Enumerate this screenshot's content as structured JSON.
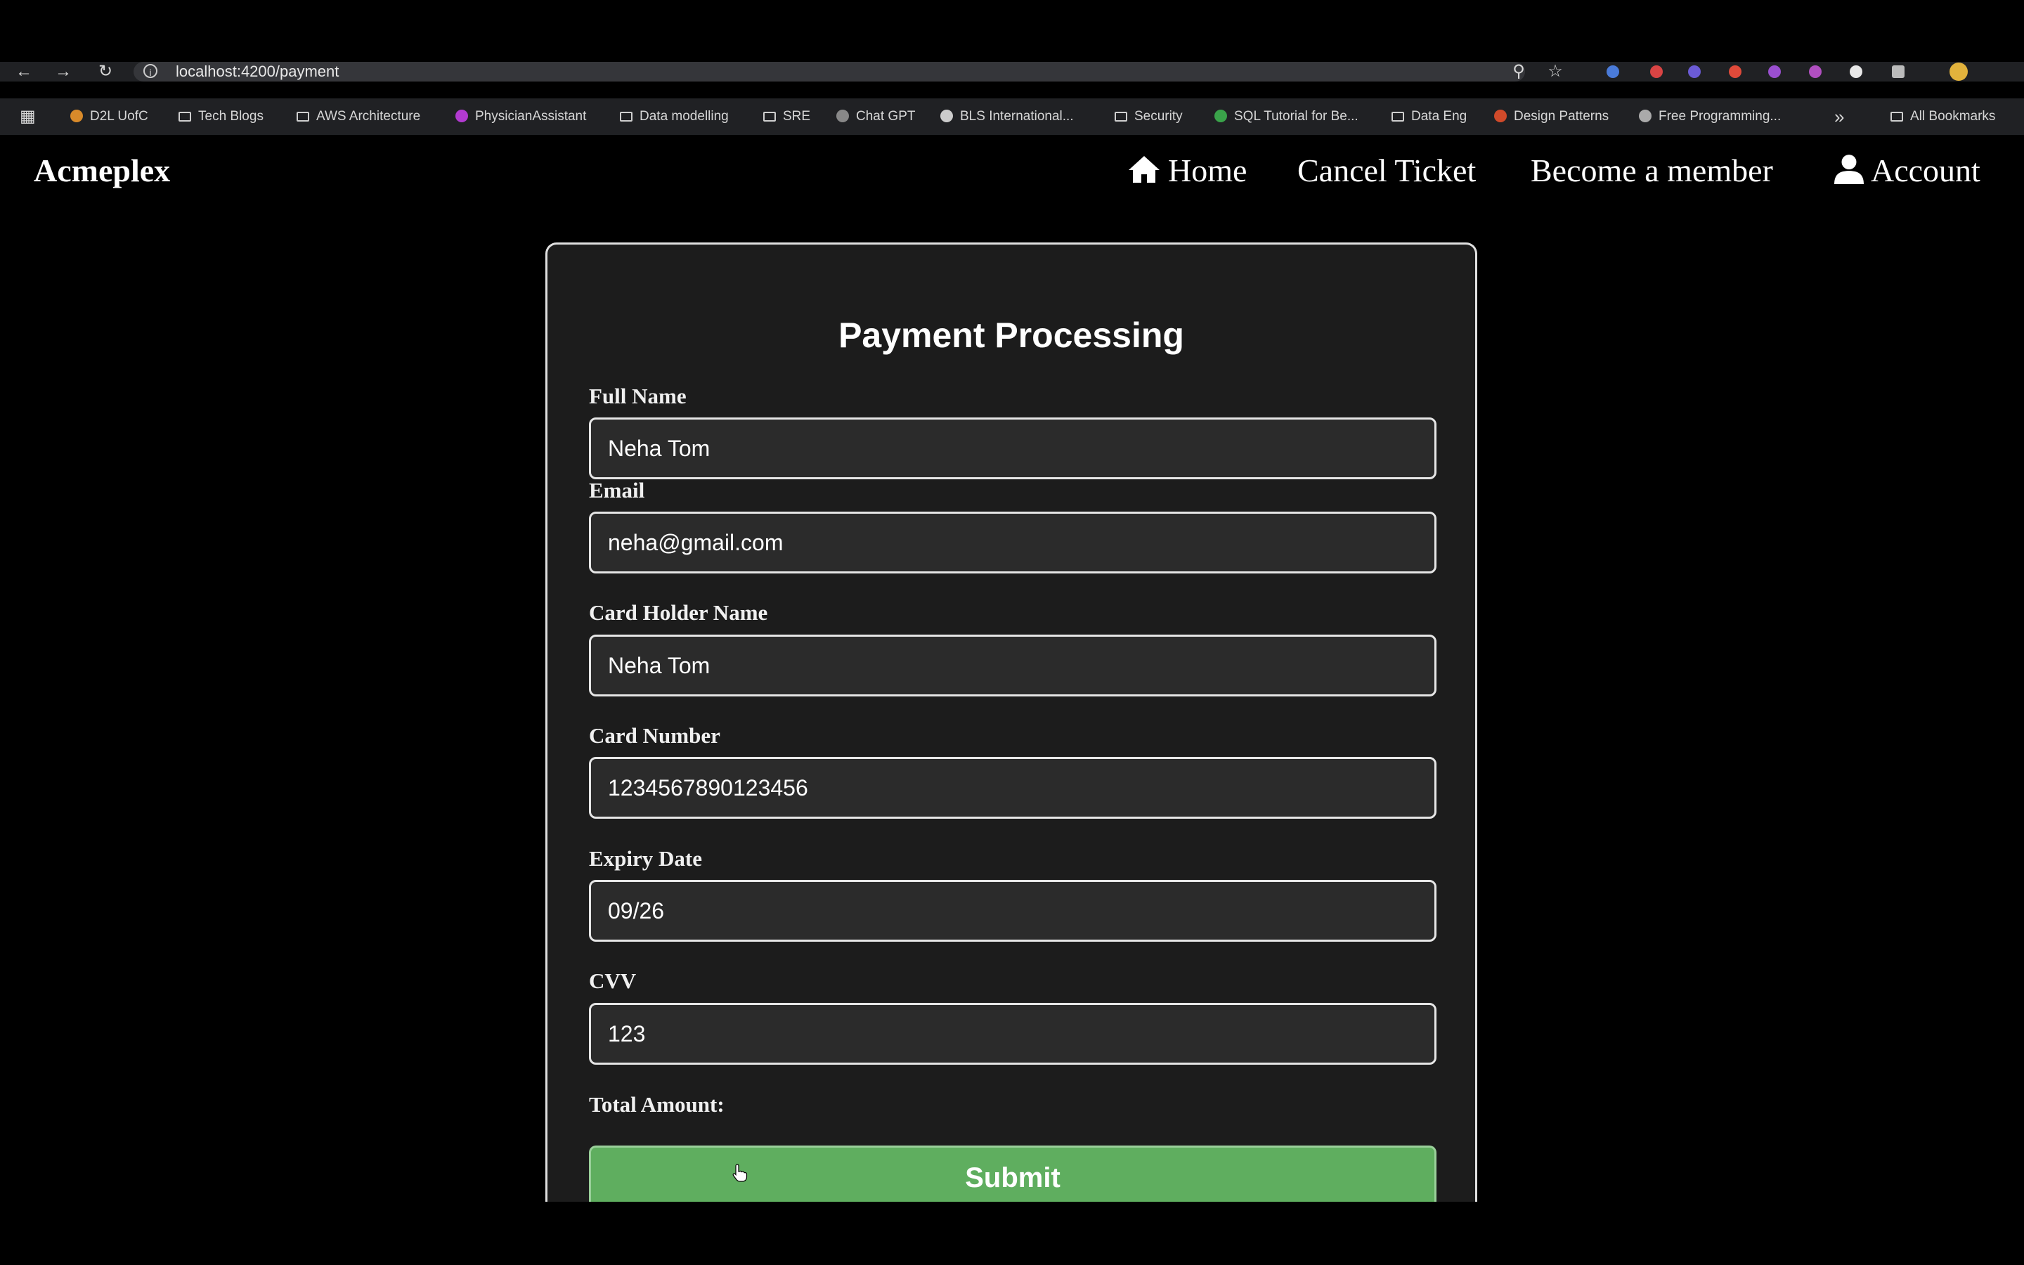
{
  "browser": {
    "url": "localhost:4200/payment",
    "bookmarks": [
      "D2L UofC",
      "Tech Blogs",
      "AWS Architecture",
      "PhysicianAssistant",
      "Data modelling",
      "SRE",
      "Chat GPT",
      "BLS International...",
      "Security",
      "SQL Tutorial for Be...",
      "Data Eng",
      "Design Patterns",
      "Free Programming..."
    ],
    "more_label": "»",
    "all_bookmarks": "All Bookmarks"
  },
  "nav": {
    "brand": "Acmeplex",
    "home": "Home",
    "cancel_ticket": "Cancel Ticket",
    "become_member": "Become a member",
    "account": "Account"
  },
  "form": {
    "title": "Payment Processing",
    "full_name_label": "Full Name",
    "full_name_value": "Neha Tom",
    "email_label": "Email",
    "email_value": "neha@gmail.com",
    "card_holder_label": "Card Holder Name",
    "card_holder_value": "Neha Tom",
    "card_number_label": "Card Number",
    "card_number_value": "1234567890123456",
    "expiry_label": "Expiry Date",
    "expiry_value": "09/26",
    "cvv_label": "CVV",
    "cvv_value": "123",
    "total_label": "Total Amount:",
    "submit_label": "Submit"
  },
  "colors": {
    "accent_green": "#5fae5f",
    "card_bg": "#1c1c1c"
  }
}
